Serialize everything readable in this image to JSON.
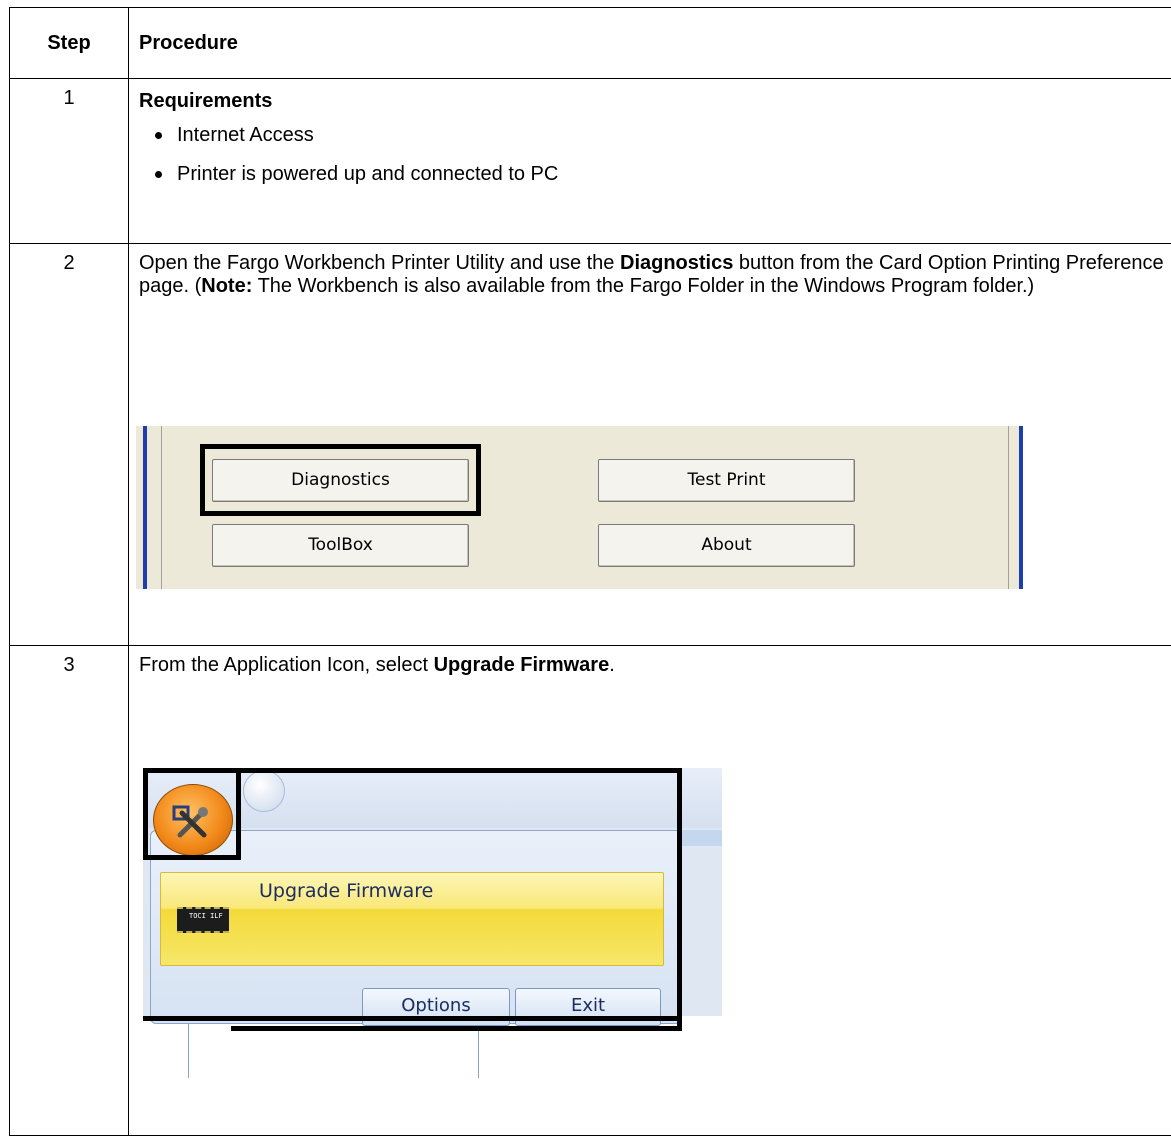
{
  "table": {
    "header": {
      "step": "Step",
      "procedure": "Procedure"
    },
    "rows": [
      {
        "step": "1",
        "title": "Requirements",
        "bullets": [
          "Internet Access",
          "Printer is powered up and connected to PC"
        ]
      },
      {
        "step": "2",
        "text_a": "Open the Fargo Workbench Printer Utility and use the ",
        "bold_a": "Diagnostics",
        "text_b": " button from the Card Option Printing Preference page. (",
        "bold_b": "Note:",
        "text_c": "  The Workbench is also available from the Fargo Folder in the Windows Program folder.)"
      },
      {
        "step": "3",
        "text_a": "From the Application Icon, select ",
        "bold_a": "Upgrade Firmware",
        "text_b": "."
      }
    ]
  },
  "screenshot1": {
    "buttons": {
      "diagnostics": "Diagnostics",
      "test_print": "Test Print",
      "toolbox": "ToolBox",
      "about": "About"
    }
  },
  "screenshot2": {
    "menu_item": "Upgrade Firmware",
    "chip_text": "TOCI ILF",
    "options_button": "Options",
    "exit_button": "Exit",
    "app_icon": "fargo-workbench-icon",
    "colors": {
      "menu_item_highlight": "#f7e76a",
      "orb": "#f28a1a"
    }
  }
}
